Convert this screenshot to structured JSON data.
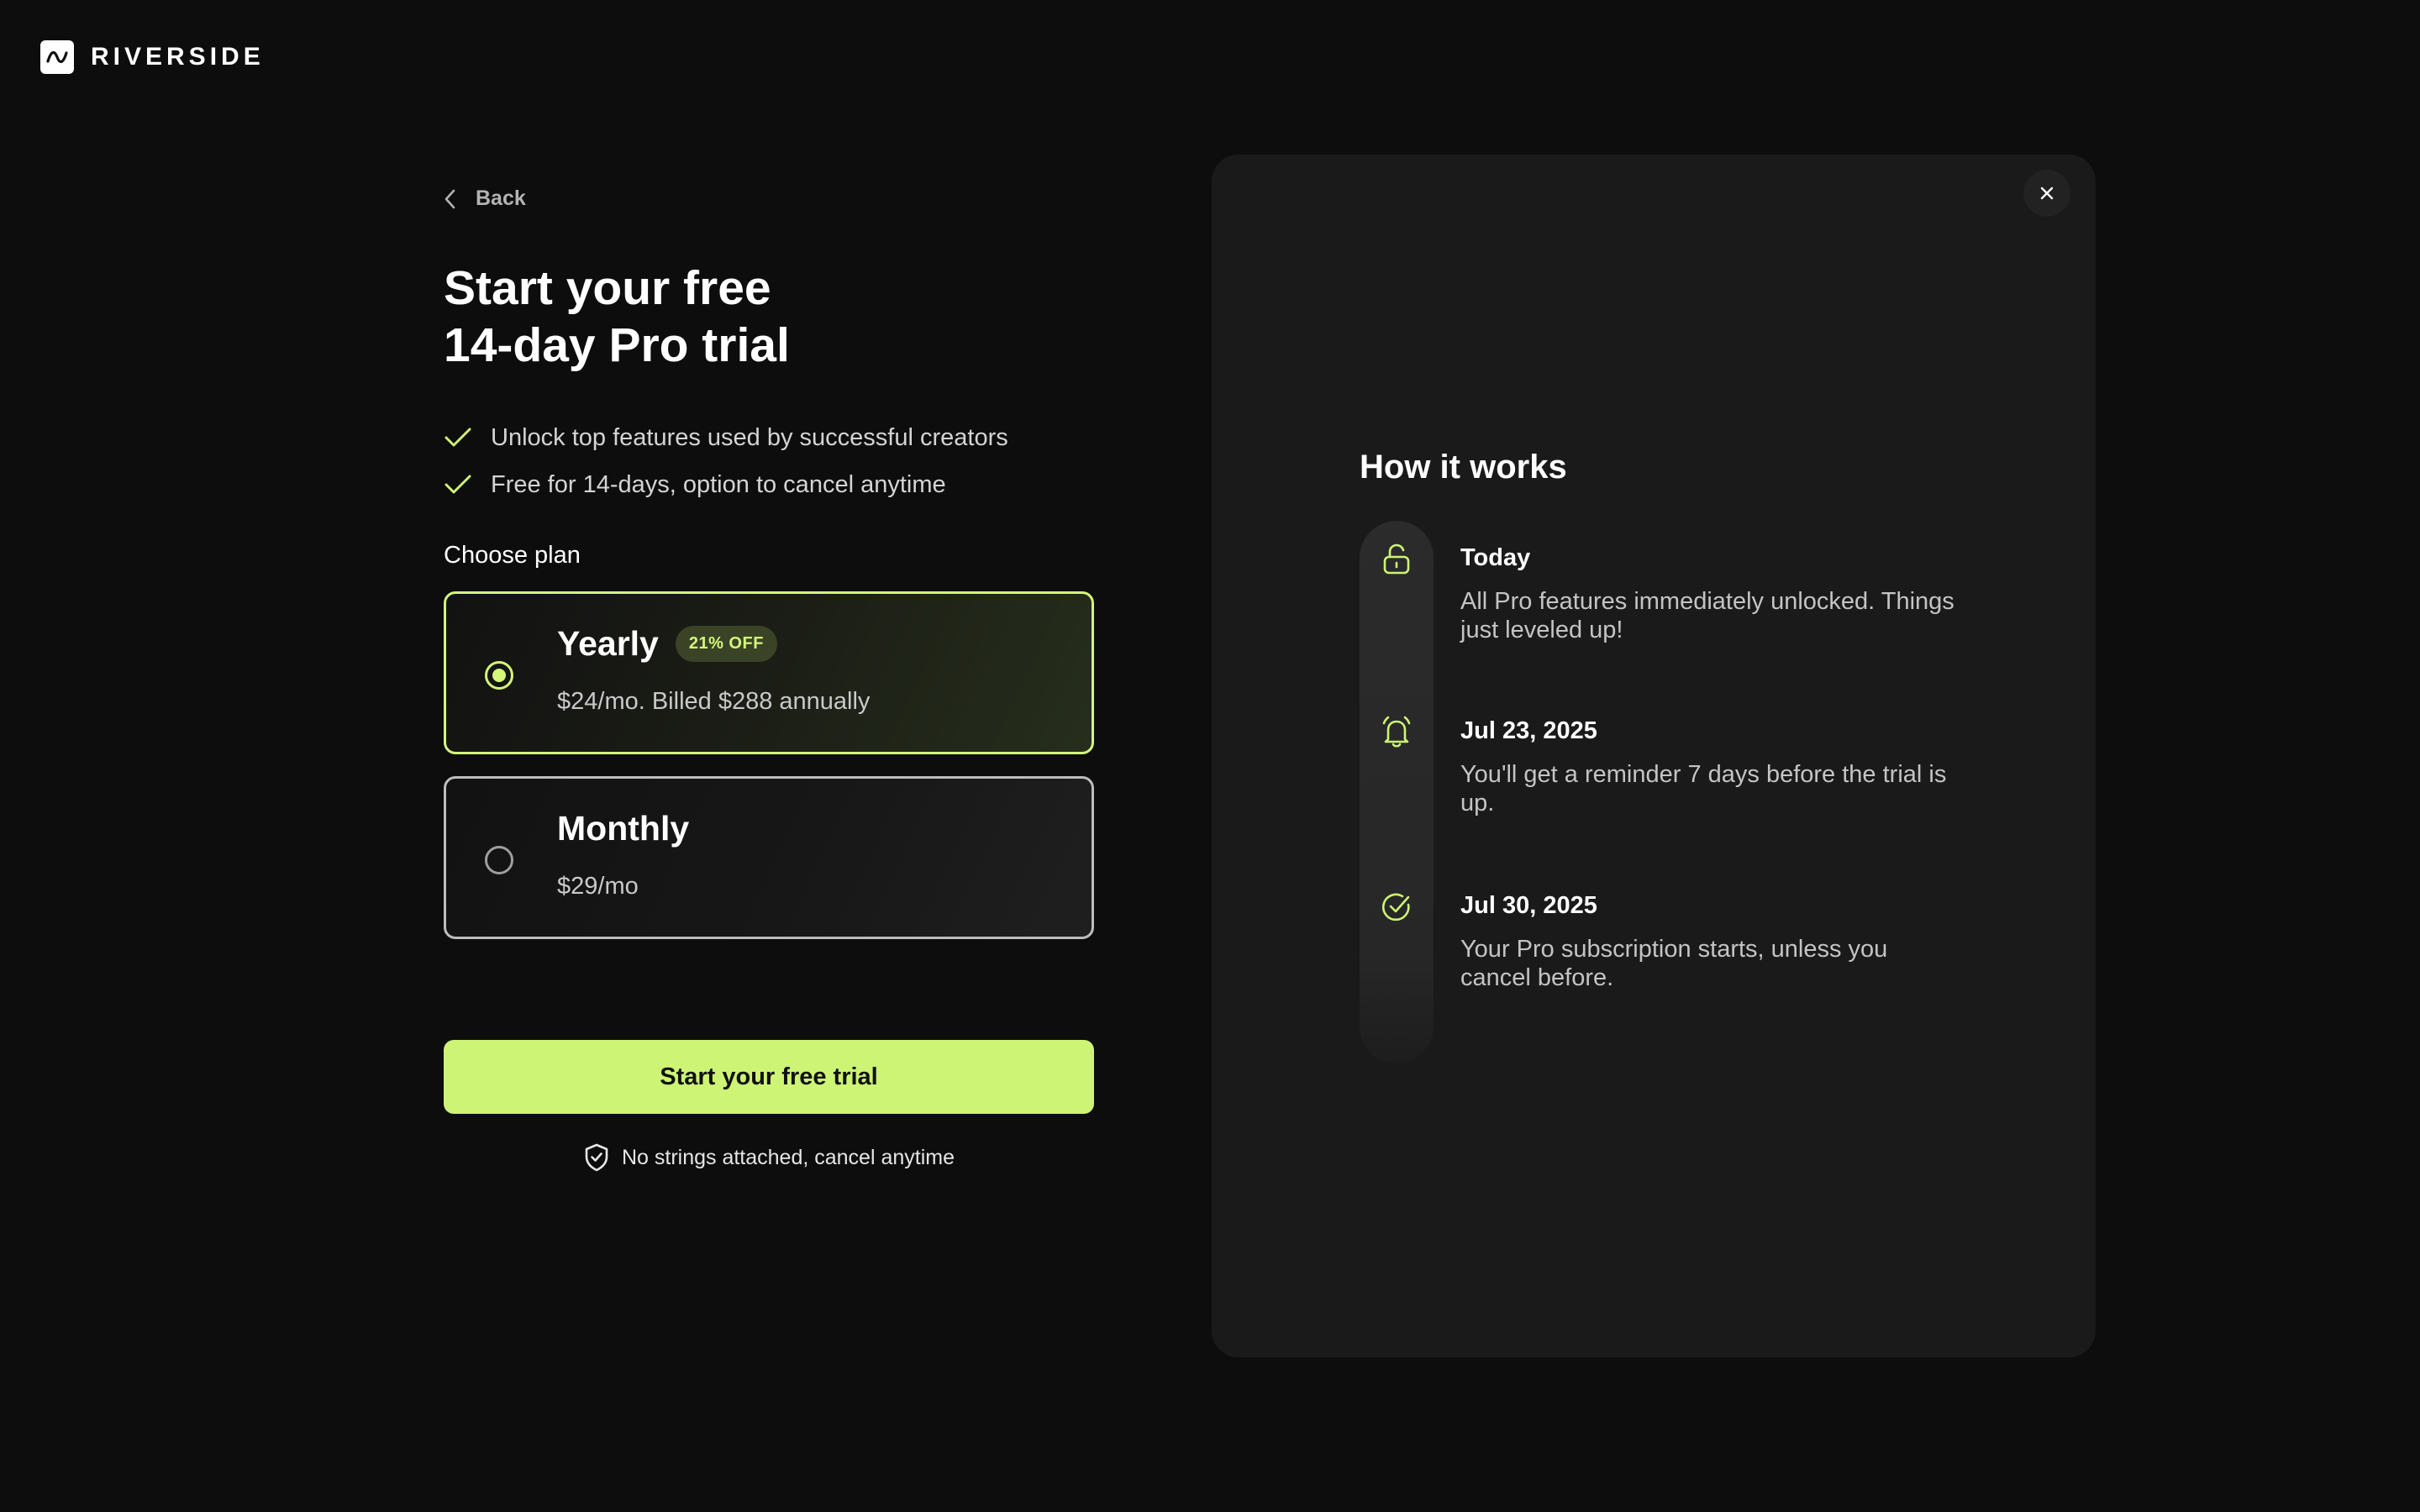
{
  "brand": {
    "name": "RIVERSIDE"
  },
  "nav": {
    "back_label": "Back"
  },
  "hero": {
    "title_line1": "Start your free",
    "title_line2": "14-day Pro trial"
  },
  "benefits": [
    "Unlock top features used by successful creators",
    "Free for 14-days, option to cancel anytime"
  ],
  "plans": {
    "heading": "Choose plan",
    "items": [
      {
        "name": "Yearly",
        "badge": "21% OFF",
        "price": "$24/mo. Billed $288 annually",
        "selected": true
      },
      {
        "name": "Monthly",
        "badge": "",
        "price": "$29/mo",
        "selected": false
      }
    ]
  },
  "cta": {
    "label": "Start your free trial",
    "note": "No strings attached, cancel anytime"
  },
  "how_it_works": {
    "title": "How it works",
    "steps": [
      {
        "icon": "unlock-icon",
        "date": "Today",
        "description": "All Pro features immediately unlocked. Things just leveled up!"
      },
      {
        "icon": "bell-icon",
        "date": "Jul 23, 2025",
        "description": "You'll get a reminder 7 days before the trial is up."
      },
      {
        "icon": "check-circle-icon",
        "date": "Jul 30, 2025",
        "description": "Your Pro subscription starts, unless you cancel before."
      }
    ]
  },
  "colors": {
    "accent": "#cdf474",
    "background": "#0d0d0d",
    "panel": "#1a1a1a"
  }
}
